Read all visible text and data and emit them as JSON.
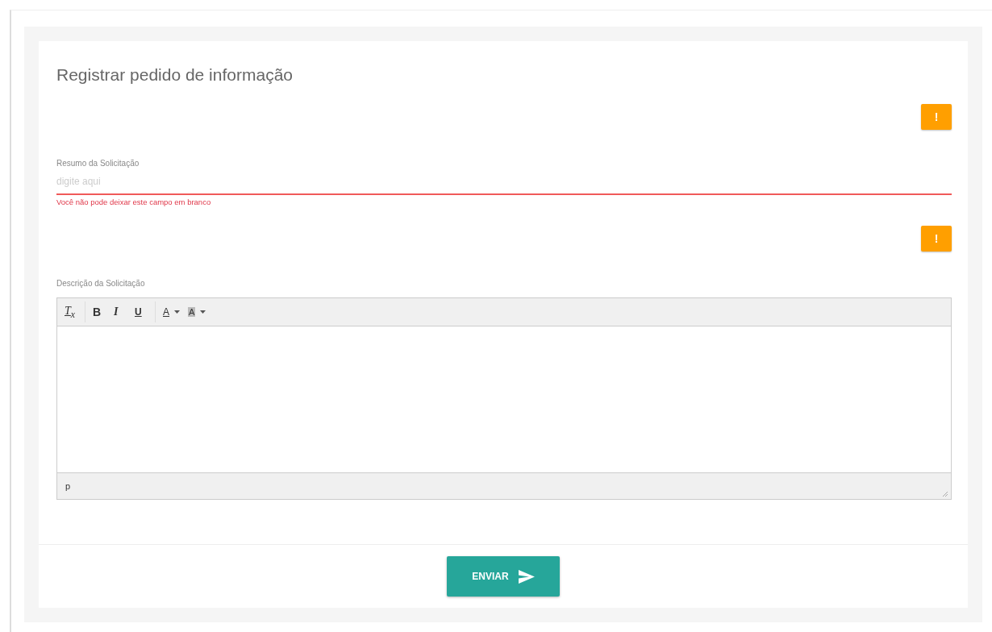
{
  "form": {
    "title": "Registrar pedido de informação",
    "fields": [
      {
        "kind": "text",
        "alert": "!",
        "label": "Resumo da Solicitação",
        "placeholder": "digite aqui",
        "invalid": true,
        "error": "Você não pode deixar este campo em branco"
      },
      {
        "kind": "editor",
        "alert": "!",
        "label": "Descrição da Solicitação",
        "toolbar": [
          {
            "kind": "clear",
            "glyph": "T$_{x}$",
            "caret": false
          },
          {
            "kind": "bold",
            "glyph": "B",
            "caret": false
          },
          {
            "kind": "italic",
            "glyph": "I",
            "caret": false
          },
          {
            "kind": "underline",
            "glyph": "U",
            "caret": false
          },
          {
            "kind": "color",
            "glyph": "A",
            "caret": true
          },
          {
            "kind": "background",
            "glyph": "A",
            "caret": true
          }
        ],
        "path": "p"
      }
    ],
    "submit": {
      "label": "ENVIAR"
    }
  }
}
